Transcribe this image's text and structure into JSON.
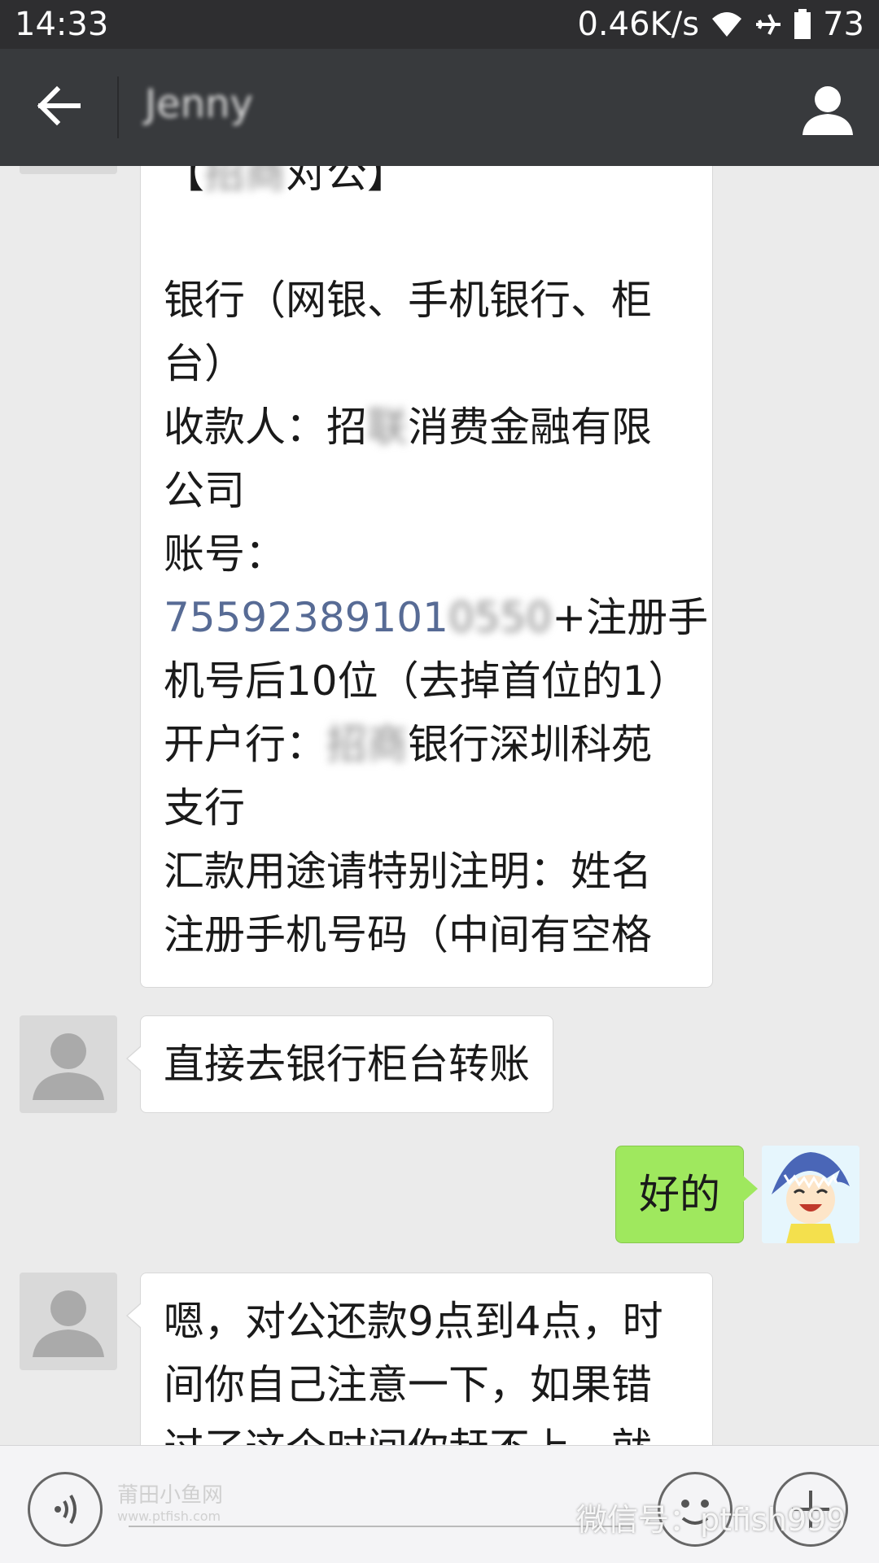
{
  "status_bar": {
    "time": "14:33",
    "net_speed": "0.46K/s",
    "battery": "73",
    "icons": [
      "wifi-icon",
      "airplane-icon",
      "battery-icon"
    ]
  },
  "header": {
    "title": "Jenny",
    "back_icon": "back-arrow-icon",
    "profile_icon": "contact-profile-icon"
  },
  "messages": [
    {
      "side": "left",
      "lines": [
        {
          "pre": "【",
          "blur": "招商",
          "post": "对公】"
        },
        {
          "pre": "",
          "blur": "",
          "post": ""
        },
        {
          "pre": "银行（网银、手机银行、柜",
          "blur": "",
          "post": ""
        },
        {
          "pre": "台）",
          "blur": "",
          "post": ""
        },
        {
          "pre": "收款人：招",
          "blur": "联",
          "post": "消费金融有限"
        },
        {
          "pre": "公司",
          "blur": "",
          "post": ""
        },
        {
          "pre": "账号：",
          "blur": "",
          "post": ""
        },
        {
          "link": "75592389101",
          "blur": "0550",
          "post": "+注册手"
        },
        {
          "pre": "机号后10位（去掉首位的1）",
          "blur": "",
          "post": ""
        },
        {
          "pre": "开户行：",
          "blur": "招商",
          "post": "银行深圳科苑"
        },
        {
          "pre": "支行",
          "blur": "",
          "post": ""
        },
        {
          "pre": "汇款用途请特别注明：姓名",
          "blur": "",
          "post": ""
        },
        {
          "pre": "注册手机号码（中间有空格",
          "blur": "",
          "post": ""
        }
      ]
    },
    {
      "side": "left",
      "text": "直接去银行柜台转账"
    },
    {
      "side": "right",
      "text": "好的"
    },
    {
      "side": "left",
      "lines": [
        {
          "pre": "嗯，对公还款9点到4点，时"
        },
        {
          "pre": "间你自己注意一下，如果错"
        },
        {
          "pre": "过了这个时间你赶不上，就"
        }
      ]
    }
  ],
  "input_bar": {
    "voice_icon": "voice-input-icon",
    "emoji_icon": "emoji-icon",
    "plus_icon": "plus-icon",
    "watermark_text": "微信号：ptfish999",
    "watermark_logo": "莆田小鱼网",
    "watermark_url": "www.ptfish.com"
  }
}
